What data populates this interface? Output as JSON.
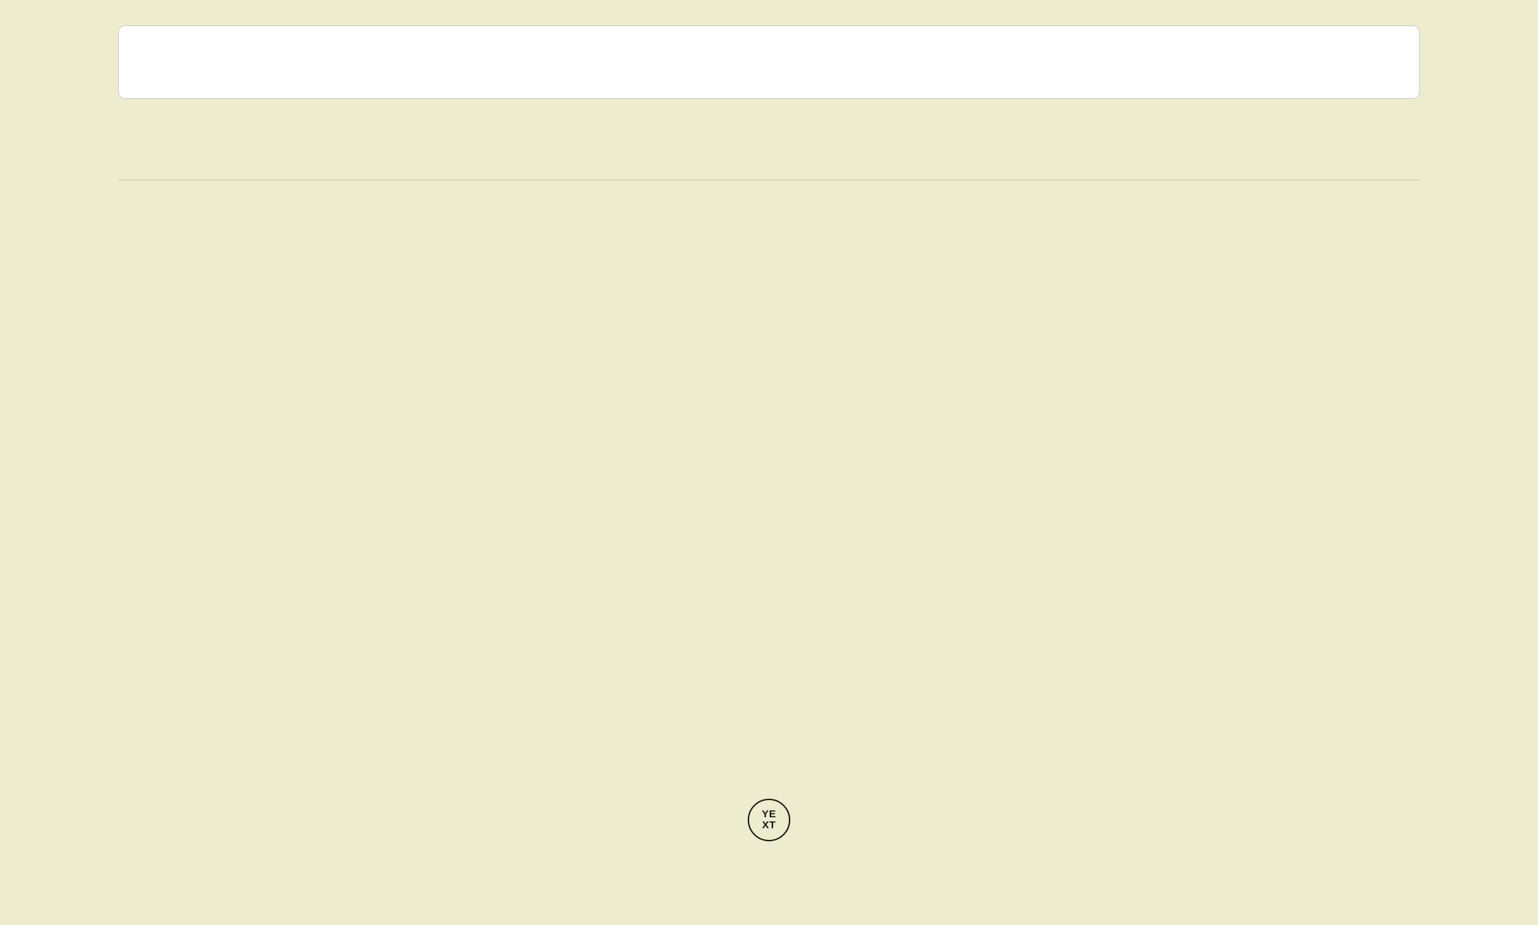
{
  "search": {
    "value": "",
    "placeholder": ""
  },
  "logo": {
    "name": "Yext",
    "line1": "YE",
    "line2": "XT"
  }
}
